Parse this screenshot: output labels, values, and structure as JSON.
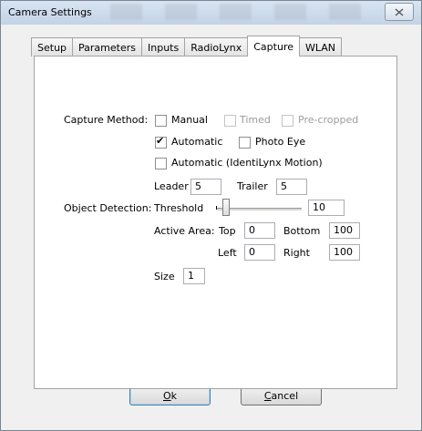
{
  "window": {
    "title": "Camera Settings"
  },
  "tabs": [
    "Setup",
    "Parameters",
    "Inputs",
    "RadioLynx",
    "Capture",
    "WLAN"
  ],
  "active_tab": "Capture",
  "capture": {
    "capture_method_label": "Capture Method:",
    "manual": {
      "label": "Manual",
      "checked": false
    },
    "timed": {
      "label": "Timed",
      "checked": false,
      "disabled": true
    },
    "precropped": {
      "label": "Pre-cropped",
      "checked": false,
      "disabled": true
    },
    "automatic": {
      "label": "Automatic",
      "checked": true
    },
    "photo_eye": {
      "label": "Photo Eye",
      "checked": false
    },
    "automatic_motion": {
      "label": "Automatic (IdentiLynx Motion)",
      "checked": false
    },
    "leader_label": "Leader",
    "leader_value": "5",
    "trailer_label": "Trailer",
    "trailer_value": "5"
  },
  "detection": {
    "object_detection_label": "Object Detection:",
    "threshold_label": "Threshold",
    "threshold_value": "10",
    "active_area_label": "Active Area:",
    "top_label": "Top",
    "top_value": "0",
    "bottom_label": "Bottom",
    "bottom_value": "100",
    "left_label": "Left",
    "left_value": "0",
    "right_label": "Right",
    "right_value": "100",
    "size_label": "Size",
    "size_value": "1"
  },
  "buttons": {
    "ok_key": "O",
    "ok_rest": "k",
    "cancel_key": "C",
    "cancel_rest": "ancel"
  },
  "icons": {
    "close": "close-x-icon",
    "check": "checkmark-icon"
  }
}
